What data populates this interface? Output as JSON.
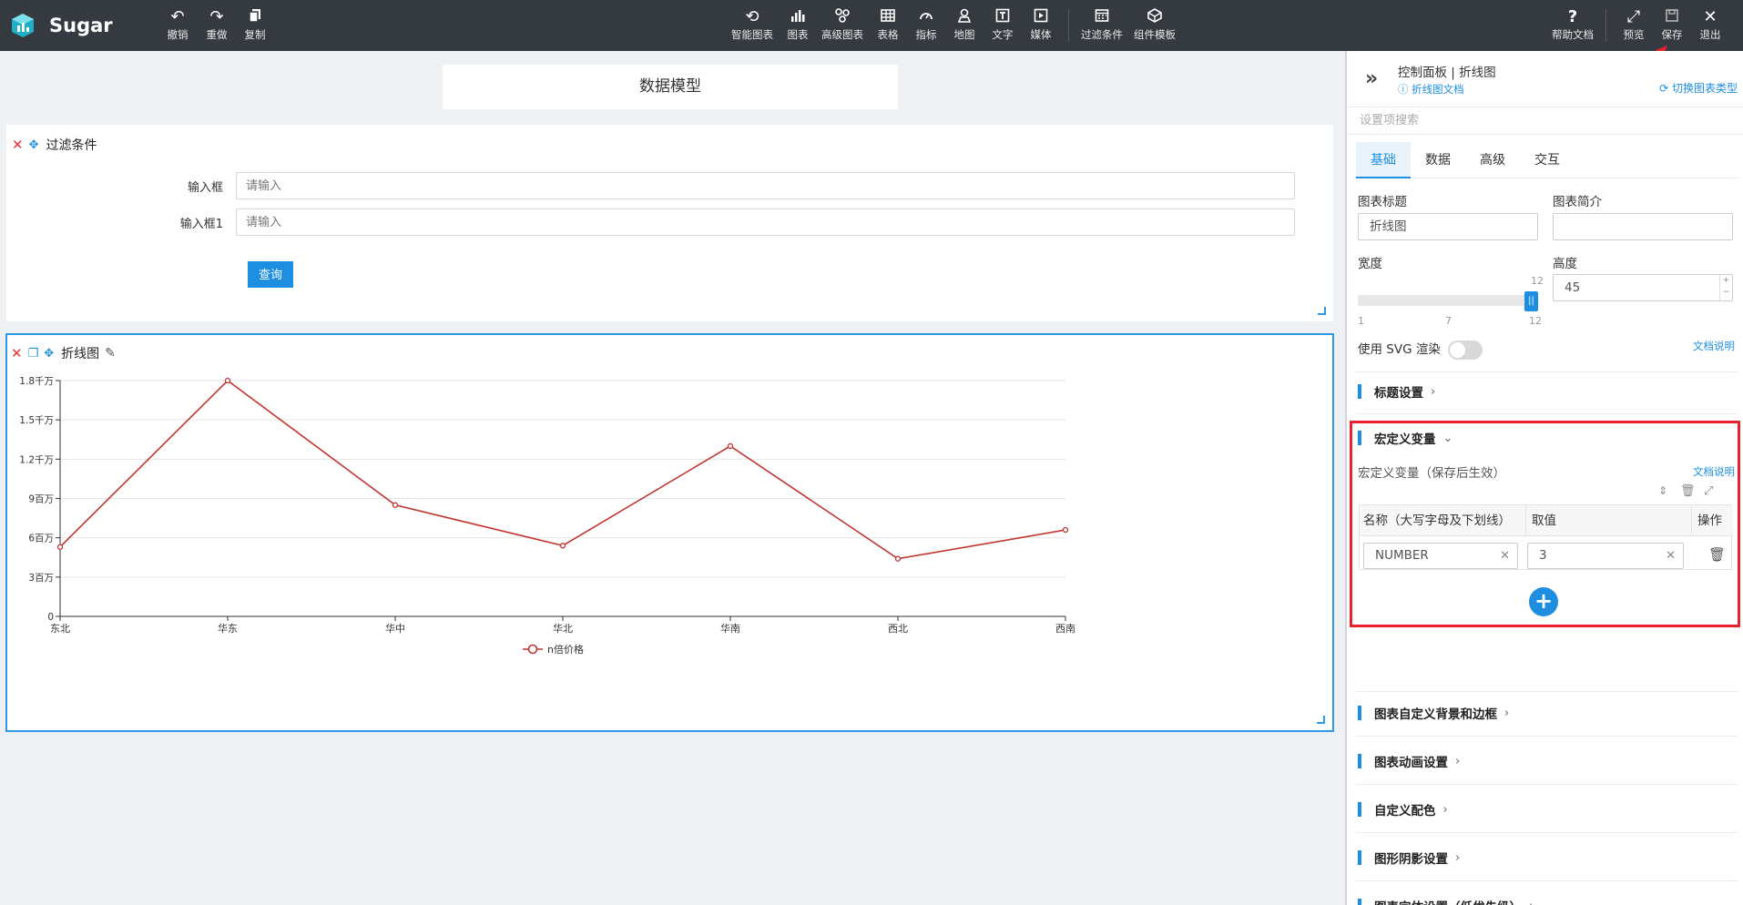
{
  "app": {
    "name": "Sugar"
  },
  "toolbar": {
    "left": [
      {
        "label": "撤销",
        "icon": "undo-icon"
      },
      {
        "label": "重做",
        "icon": "redo-icon"
      },
      {
        "label": "复制",
        "icon": "copy-icon"
      }
    ],
    "center": [
      {
        "label": "智能图表",
        "icon": "smart-chart-icon"
      },
      {
        "label": "图表",
        "icon": "bar-chart-icon"
      },
      {
        "label": "高级图表",
        "icon": "advanced-chart-icon"
      },
      {
        "label": "表格",
        "icon": "table-icon"
      },
      {
        "label": "指标",
        "icon": "gauge-icon"
      },
      {
        "label": "地图",
        "icon": "map-pin-icon"
      },
      {
        "label": "文字",
        "icon": "text-icon"
      },
      {
        "label": "媒体",
        "icon": "media-icon"
      },
      {
        "label": "过滤条件",
        "icon": "filter-icon"
      },
      {
        "label": "组件模板",
        "icon": "template-icon"
      }
    ],
    "right": [
      {
        "label": "帮助文档",
        "icon": "help-icon"
      },
      {
        "label": "预览",
        "icon": "preview-icon"
      },
      {
        "label": "保存",
        "icon": "save-icon"
      },
      {
        "label": "退出",
        "icon": "exit-icon"
      }
    ]
  },
  "canvas": {
    "model_title": "数据模型",
    "filter_panel": {
      "title": "过滤条件",
      "fields": [
        {
          "label": "输入框",
          "placeholder": "请输入"
        },
        {
          "label": "输入框1",
          "placeholder": "请输入"
        }
      ],
      "query_label": "查询"
    },
    "chart_panel": {
      "title": "折线图"
    }
  },
  "chart_data": {
    "type": "line",
    "categories": [
      "东北",
      "华东",
      "华中",
      "华北",
      "华南",
      "西北",
      "西南"
    ],
    "series": [
      {
        "name": "n倍价格",
        "values": [
          5300000,
          18000000,
          8500000,
          5400000,
          13000000,
          4400000,
          6600000
        ],
        "color": "#c23531"
      }
    ],
    "ylim": [
      0,
      18000000
    ],
    "yticks": [
      0,
      3000000,
      6000000,
      9000000,
      12000000,
      15000000,
      18000000
    ],
    "ytick_labels": [
      "0",
      "3百万",
      "6百万",
      "9百万",
      "1.2千万",
      "1.5千万",
      "1.8千万"
    ],
    "grid": true,
    "legend": "bottom-center"
  },
  "right_panel": {
    "title": "控制面板 | 折线图",
    "doc_link": "折线图文档",
    "switch_link": "切换图表类型",
    "search_placeholder": "设置项搜索",
    "tabs": [
      "基础",
      "数据",
      "高级",
      "交互"
    ],
    "active_tab": "基础",
    "chart_title_label": "图表标题",
    "chart_title_value": "折线图",
    "chart_desc_label": "图表简介",
    "chart_desc_value": "",
    "width_label": "宽度",
    "width_value": 12,
    "width_max_label": "12",
    "width_ticks": [
      "1",
      "7",
      "12"
    ],
    "height_label": "高度",
    "height_value": "45",
    "svg_render_label": "使用 SVG 渲染",
    "svg_render_on": false,
    "doc_explain": "文档说明",
    "sections": {
      "title_settings": "标题设置",
      "macro_vars": "宏定义变量",
      "bg_border": "图表自定义背景和边框",
      "animation": "图表动画设置",
      "custom_colors": "自定义配色",
      "shadow": "图形阴影设置",
      "font": "图表字体设置（低优先级）"
    },
    "macro": {
      "desc": "宏定义变量（保存后生效）",
      "col_name": "名称（大写字母及下划线）",
      "col_value": "取值",
      "col_action": "操作",
      "rows": [
        {
          "name": "NUMBER",
          "value": "3"
        }
      ]
    }
  },
  "colors": {
    "accent": "#1e8ee0",
    "topbar": "#343a40",
    "highlight": "#e8212e",
    "series": "#c23531"
  }
}
